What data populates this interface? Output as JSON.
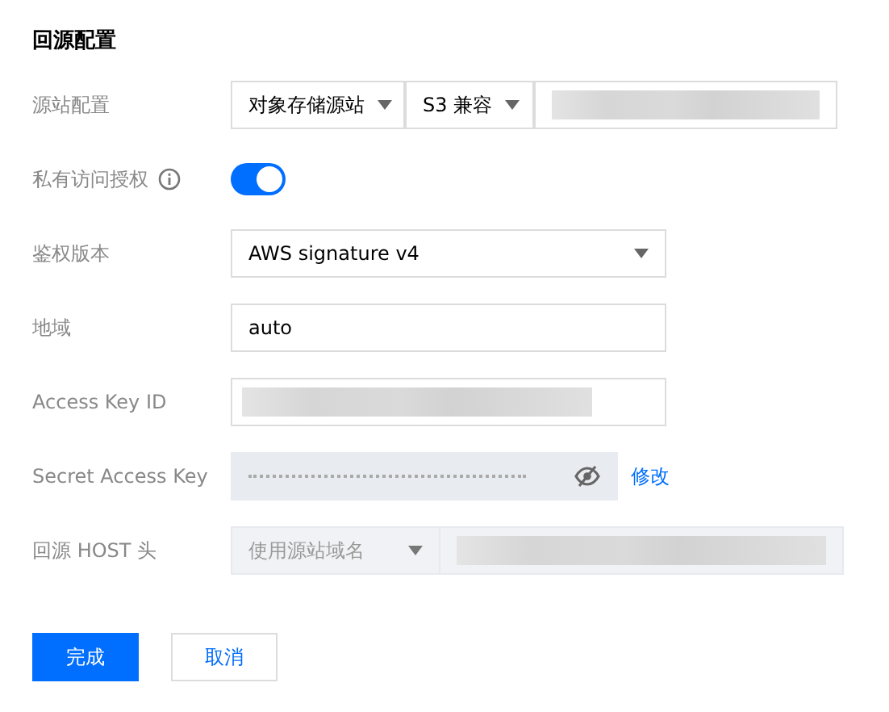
{
  "title": "回源配置",
  "rows": [
    {
      "kind": "origin",
      "label": "源站配置",
      "type_select": "对象存储源站",
      "compat_select": "S3 兼容",
      "address_redacted": true
    },
    {
      "kind": "switch",
      "label": "私有访问授权",
      "info": true,
      "on": true
    },
    {
      "kind": "select",
      "label": "鉴权版本",
      "value": "AWS signature v4"
    },
    {
      "kind": "input",
      "label": "地域",
      "value": "auto"
    },
    {
      "kind": "redacted",
      "label": "Access Key ID"
    },
    {
      "kind": "secret",
      "label": "Secret Access Key",
      "link": "修改"
    },
    {
      "kind": "host",
      "label": "回源 HOST 头",
      "select": "使用源站域名",
      "disabled": true
    }
  ],
  "buttons": [
    {
      "label": "完成",
      "primary": true
    },
    {
      "label": "取消",
      "primary": false
    }
  ]
}
